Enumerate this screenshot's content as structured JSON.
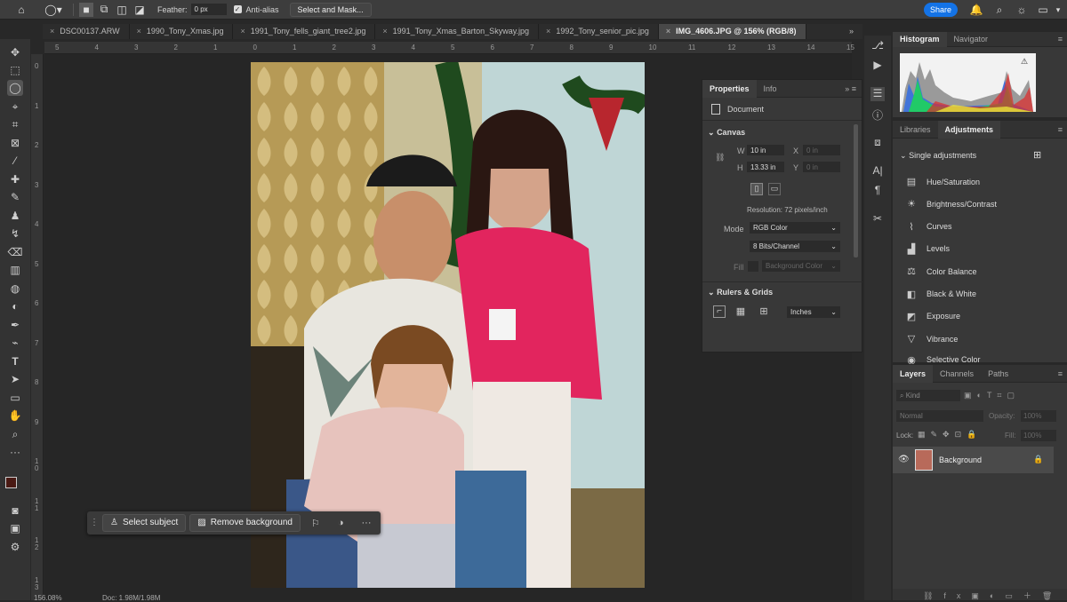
{
  "options_bar": {
    "feather_label": "Feather:",
    "feather_value": "0 px",
    "antialias_label": "Anti-alias",
    "select_mask_label": "Select and Mask...",
    "share_label": "Share"
  },
  "tabs": [
    {
      "label": "DSC00137.ARW"
    },
    {
      "label": "1990_Tony_Xmas.jpg"
    },
    {
      "label": "1991_Tony_fells_giant_tree2.jpg"
    },
    {
      "label": "1991_Tony_Xmas_Barton_Skyway.jpg"
    },
    {
      "label": "1992_Tony_senior_pic.jpg"
    },
    {
      "label": "IMG_4606.JPG @ 156% (RGB/8)"
    }
  ],
  "ruler_h": [
    "5",
    "4",
    "3",
    "2",
    "1",
    "0",
    "1",
    "2",
    "3",
    "4",
    "5",
    "6",
    "7",
    "8",
    "9",
    "10",
    "11",
    "12",
    "13",
    "14",
    "15"
  ],
  "ruler_v": [
    "0",
    "1",
    "2",
    "3",
    "4",
    "5",
    "6",
    "7",
    "8",
    "9",
    "1 0",
    "1 1",
    "1 2",
    "1 3"
  ],
  "properties": {
    "tab_properties": "Properties",
    "tab_info": "Info",
    "document_label": "Document",
    "canvas_label": "Canvas",
    "w_label": "W",
    "w_value": "10 in",
    "h_label": "H",
    "h_value": "13.33 in",
    "x_label": "X",
    "x_value": "0 in",
    "y_label": "Y",
    "y_value": "0 in",
    "resolution": "Resolution: 72 pixels/inch",
    "mode_label": "Mode",
    "mode_value": "RGB Color",
    "bits_value": "8 Bits/Channel",
    "fill_label": "Fill",
    "fill_value": "Background Color",
    "rulers_label": "Rulers & Grids",
    "units_value": "Inches"
  },
  "histogram": {
    "tab_histogram": "Histogram",
    "tab_navigator": "Navigator"
  },
  "adjustments": {
    "tab_libraries": "Libraries",
    "tab_adjustments": "Adjustments",
    "section": "Single adjustments",
    "items": [
      {
        "label": "Hue/Saturation",
        "icon": "hue-saturation-icon"
      },
      {
        "label": "Brightness/Contrast",
        "icon": "brightness-icon"
      },
      {
        "label": "Curves",
        "icon": "curves-icon"
      },
      {
        "label": "Levels",
        "icon": "levels-icon"
      },
      {
        "label": "Color Balance",
        "icon": "color-balance-icon"
      },
      {
        "label": "Black & White",
        "icon": "black-white-icon"
      },
      {
        "label": "Exposure",
        "icon": "exposure-icon"
      },
      {
        "label": "Vibrance",
        "icon": "vibrance-icon"
      },
      {
        "label": "Selective Color",
        "icon": "selective-color-icon"
      }
    ]
  },
  "layers": {
    "tab_layers": "Layers",
    "tab_channels": "Channels",
    "tab_paths": "Paths",
    "kind_label": "Kind",
    "blend_value": "Normal",
    "opacity_label": "Opacity:",
    "opacity_value": "100%",
    "lock_label": "Lock:",
    "fill_label": "Fill:",
    "fill_value": "100%",
    "layer_name": "Background"
  },
  "context_bar": {
    "select_subject": "Select subject",
    "remove_background": "Remove background"
  },
  "status": {
    "zoom": "156.08%",
    "doc": "Doc: 1.98M/1.98M"
  },
  "colors": {
    "accent": "#1473e6",
    "foreground": "#4a1a14",
    "background": "#1a2a55"
  }
}
